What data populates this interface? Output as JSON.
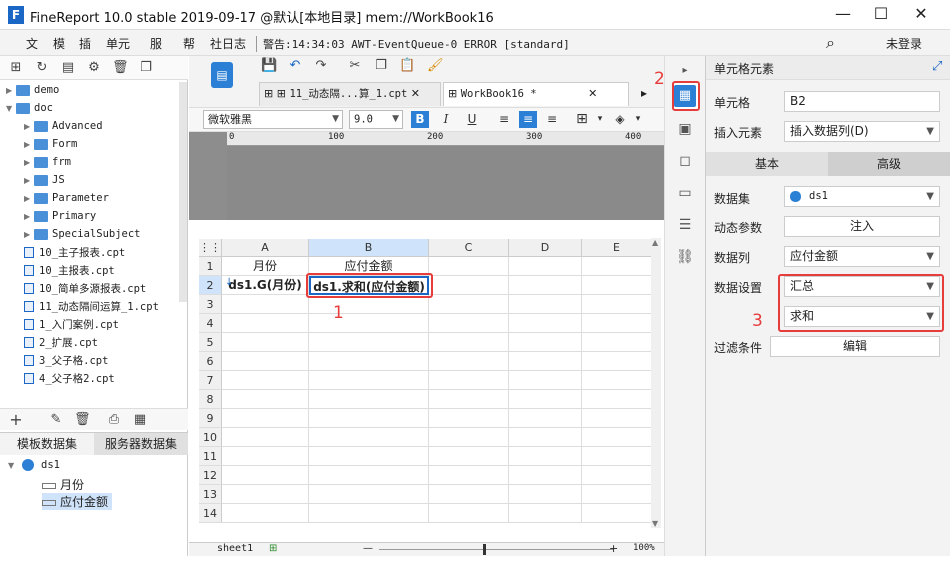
{
  "window": {
    "title": "FineReport 10.0 stable 2019-09-17 @默认[本地目录]    mem://WorkBook16"
  },
  "menu": {
    "items": [
      "文",
      "模",
      "插",
      "单元",
      "服",
      "帮",
      "社",
      "日志"
    ],
    "status": "警告:14:34:03 AWT-EventQueue-0 ERROR [standard]",
    "login": "未登录"
  },
  "tree": {
    "items": [
      {
        "label": "demo",
        "type": "folder",
        "level": 0,
        "expanded": false
      },
      {
        "label": "doc",
        "type": "folder",
        "level": 0,
        "expanded": true
      },
      {
        "label": "Advanced",
        "type": "folder",
        "level": 1
      },
      {
        "label": "Form",
        "type": "folder",
        "level": 1
      },
      {
        "label": "frm",
        "type": "folder",
        "level": 1
      },
      {
        "label": "JS",
        "type": "folder",
        "level": 1
      },
      {
        "label": "Parameter",
        "type": "folder",
        "level": 1
      },
      {
        "label": "Primary",
        "type": "folder",
        "level": 1
      },
      {
        "label": "SpecialSubject",
        "type": "folder",
        "level": 1
      },
      {
        "label": "10_主子报表.cpt",
        "type": "file",
        "level": 1
      },
      {
        "label": "10_主报表.cpt",
        "type": "file",
        "level": 1
      },
      {
        "label": "10_简单多源报表.cpt",
        "type": "file",
        "level": 1
      },
      {
        "label": "11_动态隔间运算_1.cpt",
        "type": "file",
        "level": 1
      },
      {
        "label": "1_入门案例.cpt",
        "type": "file",
        "level": 1
      },
      {
        "label": "2_扩展.cpt",
        "type": "file",
        "level": 1
      },
      {
        "label": "3_父子格.cpt",
        "type": "file",
        "level": 1
      },
      {
        "label": "4_父子格2.cpt",
        "type": "file",
        "level": 1
      }
    ]
  },
  "datasets": {
    "tab_template": "模板数据集",
    "tab_server": "服务器数据集",
    "root": "ds1",
    "fields": [
      "月份",
      "应付金额"
    ]
  },
  "editor": {
    "tabs": [
      "11_动态隔...算_1.cpt",
      "WorkBook16 *"
    ],
    "font": "微软雅黑",
    "font_size": "9.0",
    "ruler_ticks": [
      "0",
      "100",
      "200",
      "300",
      "400"
    ],
    "columns": [
      "A",
      "B",
      "C",
      "D",
      "E"
    ],
    "rows": [
      "1",
      "2",
      "3",
      "4",
      "5",
      "6",
      "7",
      "8",
      "9",
      "10",
      "11",
      "12",
      "13",
      "14"
    ],
    "cells": {
      "A1": "月份",
      "B1": "应付金额",
      "A2": "ds1.G(月份)",
      "B2": "ds1.求和(应付金额)"
    },
    "sheet_name": "sheet1",
    "zoom": "100%"
  },
  "annotations": {
    "n1": "1",
    "n2": "2",
    "n3": "3"
  },
  "panel": {
    "title": "单元格元素",
    "cell_label": "单元格",
    "cell_value": "B2",
    "insert_label": "插入元素",
    "insert_value": "插入数据列(D)",
    "tab_basic": "基本",
    "tab_advanced": "高级",
    "dataset_label": "数据集",
    "dataset_value": "ds1",
    "dyn_label": "动态参数",
    "dyn_button": "注入",
    "column_label": "数据列",
    "column_value": "应付金额",
    "setting_label": "数据设置",
    "setting_value": "汇总",
    "setting_func": "求和",
    "filter_label": "过滤条件",
    "filter_button": "编辑"
  },
  "colors": {
    "accent": "#1a67c5",
    "red": "#e63c3c",
    "selected": "#cfe3fa"
  }
}
